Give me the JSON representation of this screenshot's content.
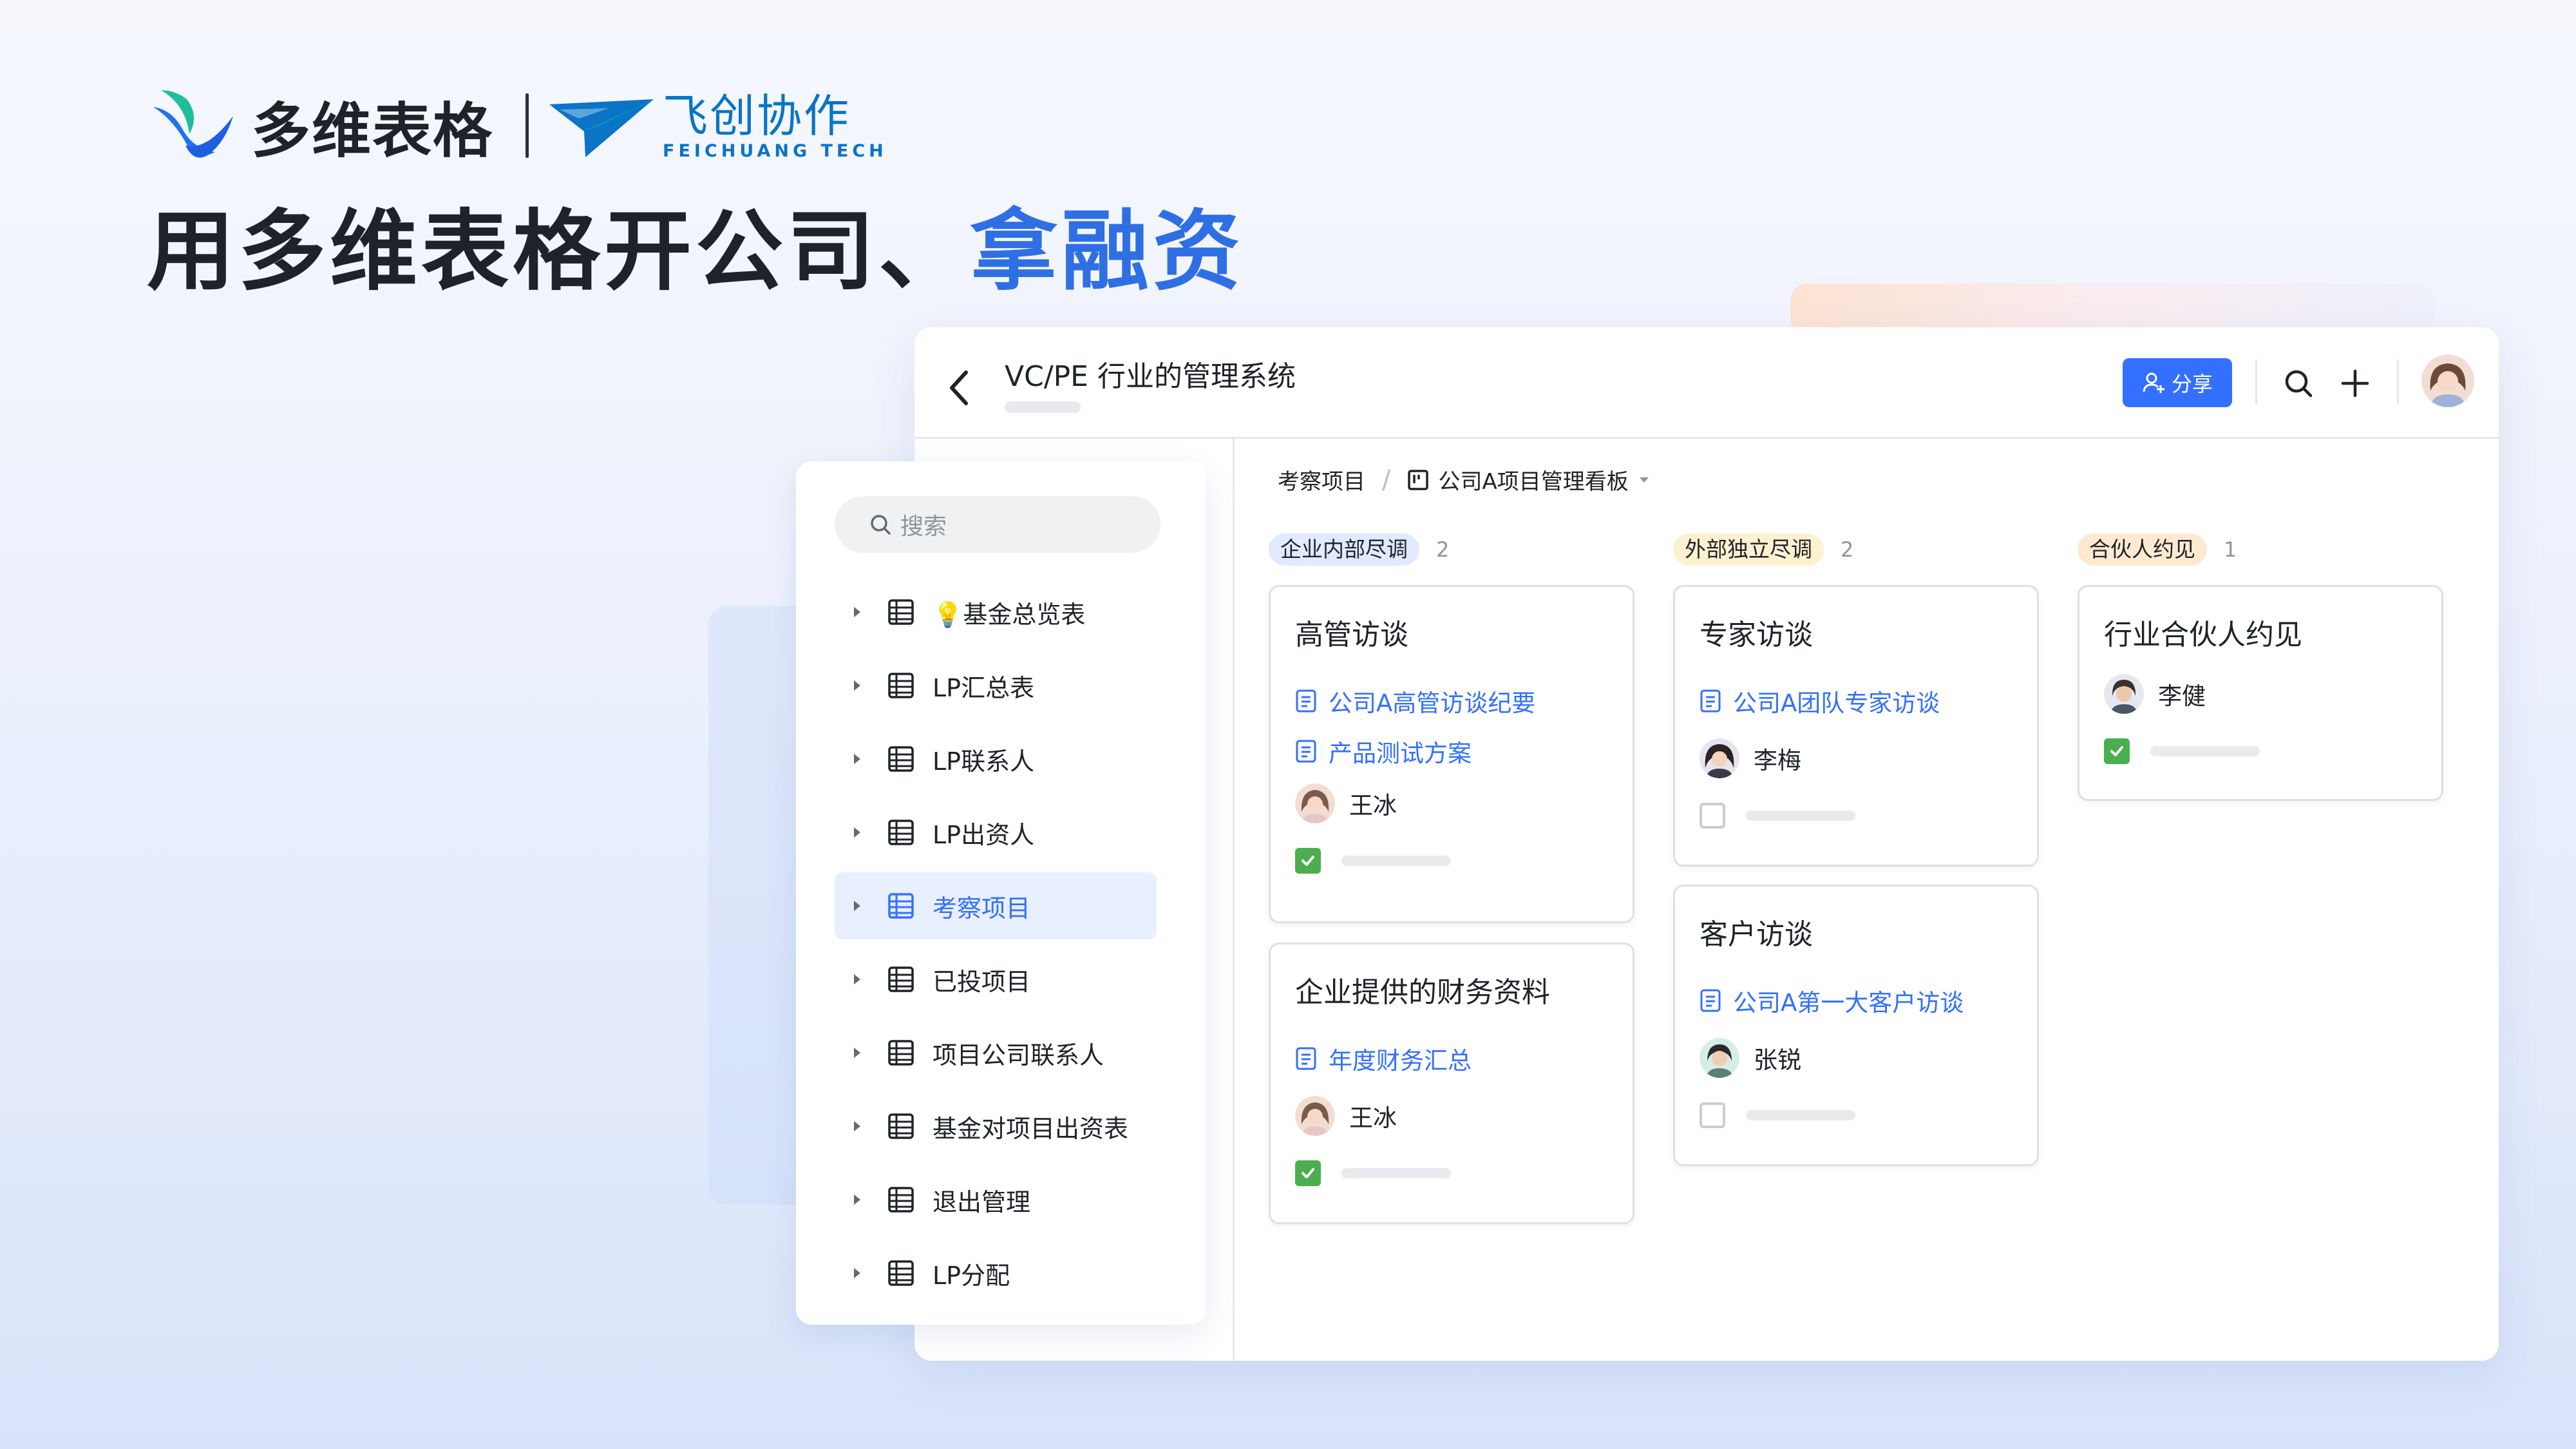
{
  "brand": {
    "product_name": "多维表格",
    "partner_name": "飞创协作",
    "partner_en": "FEICHUANG TECH",
    "colors": {
      "accent": "#2f6fe4",
      "partner": "#0a74c7"
    }
  },
  "headline": {
    "main": "用多维表格开公司、",
    "accent": "拿融资"
  },
  "window": {
    "title": "VC/PE 行业的管理系统",
    "share_label": "分享",
    "header_icons": [
      "back-icon",
      "search-icon",
      "plus-icon",
      "avatar"
    ]
  },
  "breadcrumb": {
    "parent": "考察项目",
    "view": "公司A项目管理看板"
  },
  "columns": [
    {
      "name": "企业内部尽调",
      "count": "2",
      "tag_color": "#e1eaff",
      "cards": [
        {
          "title": "高管访谈",
          "docs": [
            "公司A高管访谈纪要",
            "产品测试方案"
          ],
          "person": "王冰",
          "checked": true
        },
        {
          "title": "企业提供的财务资料",
          "docs": [
            "年度财务汇总"
          ],
          "person": "王冰",
          "checked": true
        }
      ]
    },
    {
      "name": "外部独立尽调",
      "count": "2",
      "tag_color": "#fdf1cf",
      "cards": [
        {
          "title": "专家访谈",
          "docs": [
            "公司A团队专家访谈"
          ],
          "person": "李梅",
          "checked": false
        },
        {
          "title": "客户访谈",
          "docs": [
            "公司A第一大客户访谈"
          ],
          "person": "张锐",
          "checked": false
        }
      ]
    },
    {
      "name": "合伙人约见",
      "count": "1",
      "tag_color": "#feead2",
      "cards": [
        {
          "title": "行业合伙人约见",
          "docs": [],
          "person": "李健",
          "checked": true
        }
      ]
    }
  ],
  "sidebar": {
    "search_placeholder": "搜索",
    "items": [
      {
        "label": "💡基金总览表",
        "active": false
      },
      {
        "label": "LP汇总表",
        "active": false
      },
      {
        "label": "LP联系人",
        "active": false
      },
      {
        "label": "LP出资人",
        "active": false
      },
      {
        "label": "考察项目",
        "active": true
      },
      {
        "label": "已投项目",
        "active": false
      },
      {
        "label": "项目公司联系人",
        "active": false
      },
      {
        "label": "基金对项目出资表",
        "active": false
      },
      {
        "label": "退出管理",
        "active": false
      },
      {
        "label": "LP分配",
        "active": false
      }
    ]
  }
}
